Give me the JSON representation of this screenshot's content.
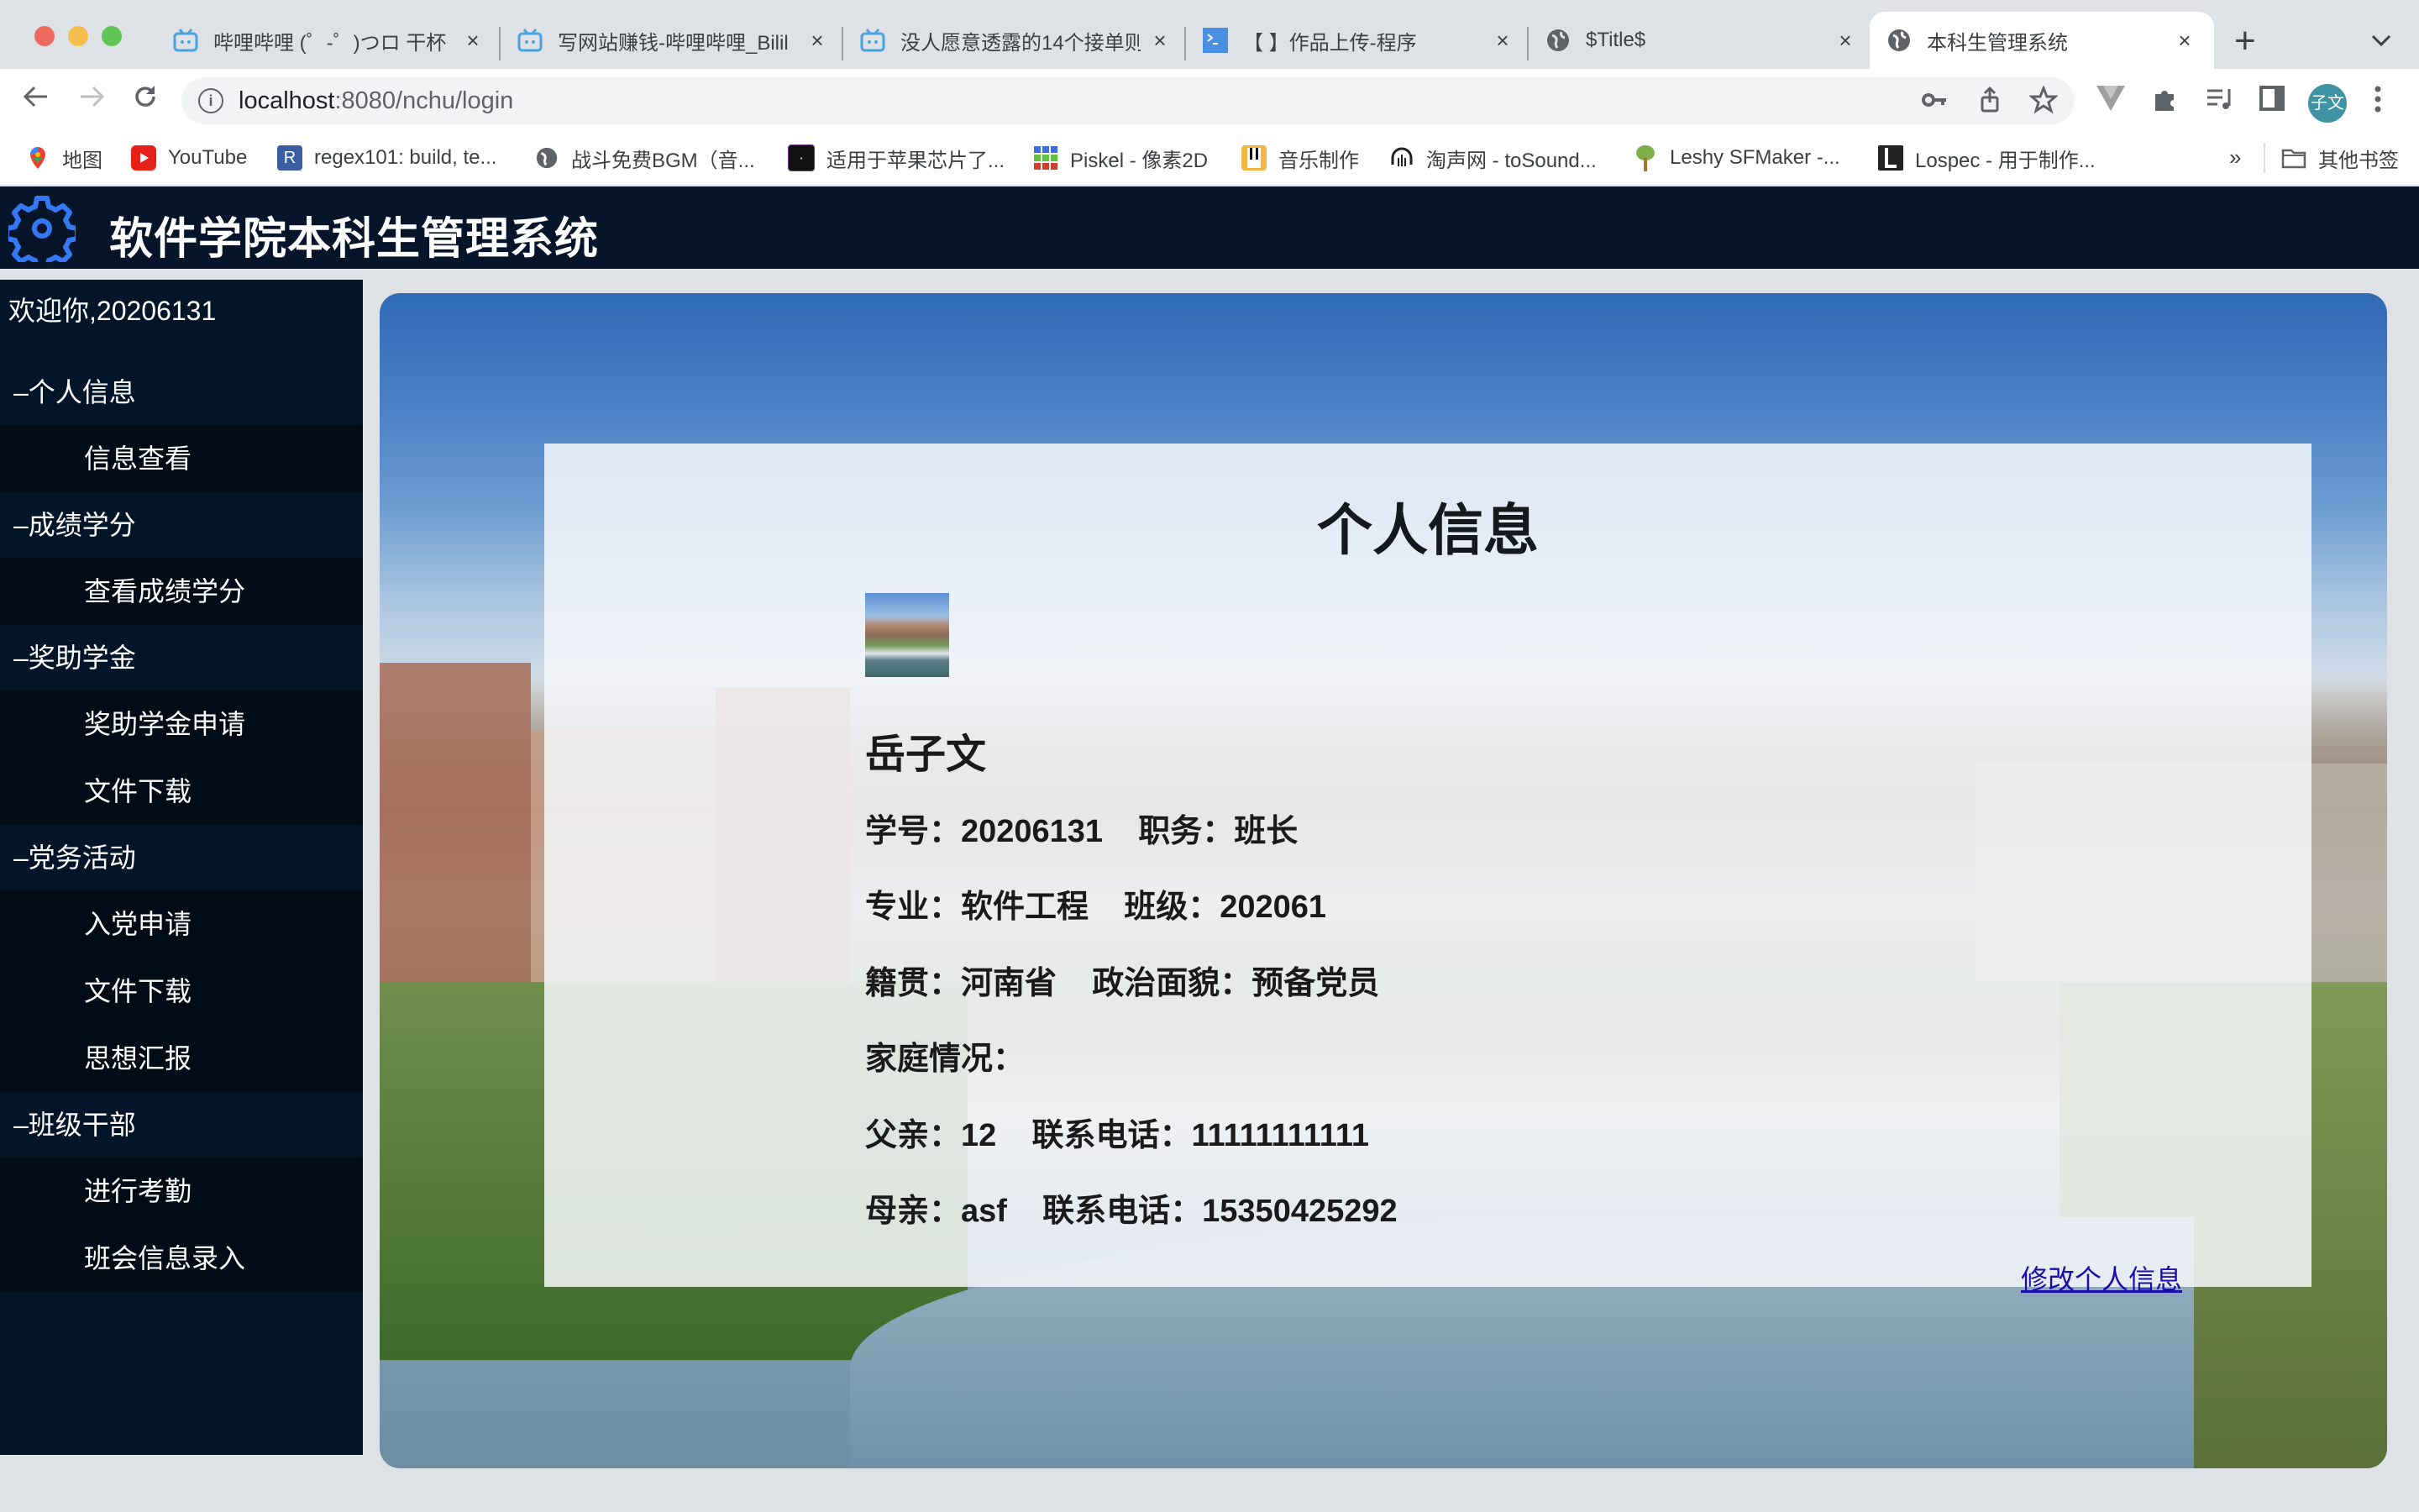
{
  "browser": {
    "tabs": [
      {
        "title": "哔哩哔哩 (゜-゜)つロ 干杯",
        "icon": "bilibili-icon",
        "active": false
      },
      {
        "title": "写网站赚钱-哔哩哔哩_Bilil",
        "icon": "bilibili-icon",
        "active": false
      },
      {
        "title": "没人愿意透露的14个接单则",
        "icon": "bilibili-icon",
        "active": false
      },
      {
        "title": "【        】作品上传-程序",
        "icon": "terminal-icon",
        "active": false
      },
      {
        "title": "$Title$",
        "icon": "globe-icon",
        "active": false
      },
      {
        "title": "本科生管理系统",
        "icon": "globe-icon",
        "active": true
      }
    ],
    "new_tab_label": "+",
    "tab_menu_label": "⌄",
    "url_host": "localhost",
    "url_rest": ":8080/nchu/login",
    "profile_label": "子文",
    "bookmarks": [
      {
        "label": "地图",
        "icon": "maps-icon"
      },
      {
        "label": "YouTube",
        "icon": "youtube-icon"
      },
      {
        "label": "regex101: build, te...",
        "icon": "regex101-icon"
      },
      {
        "label": "战斗免费BGM（音...",
        "icon": "globe-icon"
      },
      {
        "label": "适用于苹果芯片了...",
        "icon": "app-icon"
      },
      {
        "label": "Piskel - 像素2D",
        "icon": "piskel-icon"
      },
      {
        "label": "音乐制作",
        "icon": "piano-icon"
      },
      {
        "label": "淘声网 - toSound...",
        "icon": "headphones-icon"
      },
      {
        "label": "Leshy SFMaker -...",
        "icon": "tree-icon"
      },
      {
        "label": "Lospec - 用于制作...",
        "icon": "lospec-icon"
      }
    ],
    "bookmarks_more": "»",
    "other_bookmarks": "其他书签"
  },
  "app": {
    "title": "软件学院本科生管理系统",
    "accent": "#2f6fe0",
    "sidebar": {
      "welcome": "欢迎你,20206131",
      "groups": [
        {
          "label": "–个人信息",
          "items": [
            "信息查看"
          ]
        },
        {
          "label": "–成绩学分",
          "items": [
            "查看成绩学分"
          ]
        },
        {
          "label": "–奖助学金",
          "items": [
            "奖助学金申请",
            "文件下载"
          ]
        },
        {
          "label": "–党务活动",
          "items": [
            "入党申请",
            "文件下载",
            "思想汇报"
          ]
        },
        {
          "label": "–班级干部",
          "items": [
            "进行考勤",
            "班会信息录入"
          ]
        }
      ]
    },
    "profile": {
      "heading": "个人信息",
      "name": "岳子文",
      "lines": [
        "学号：20206131    职务：班长",
        "专业：软件工程    班级：202061",
        "籍贯：河南省    政治面貌：预备党员",
        "家庭情况：",
        "父亲：12    联系电话：11111111111",
        "母亲：asf    联系电话：15350425292"
      ],
      "edit_link": "修改个人信息"
    }
  }
}
